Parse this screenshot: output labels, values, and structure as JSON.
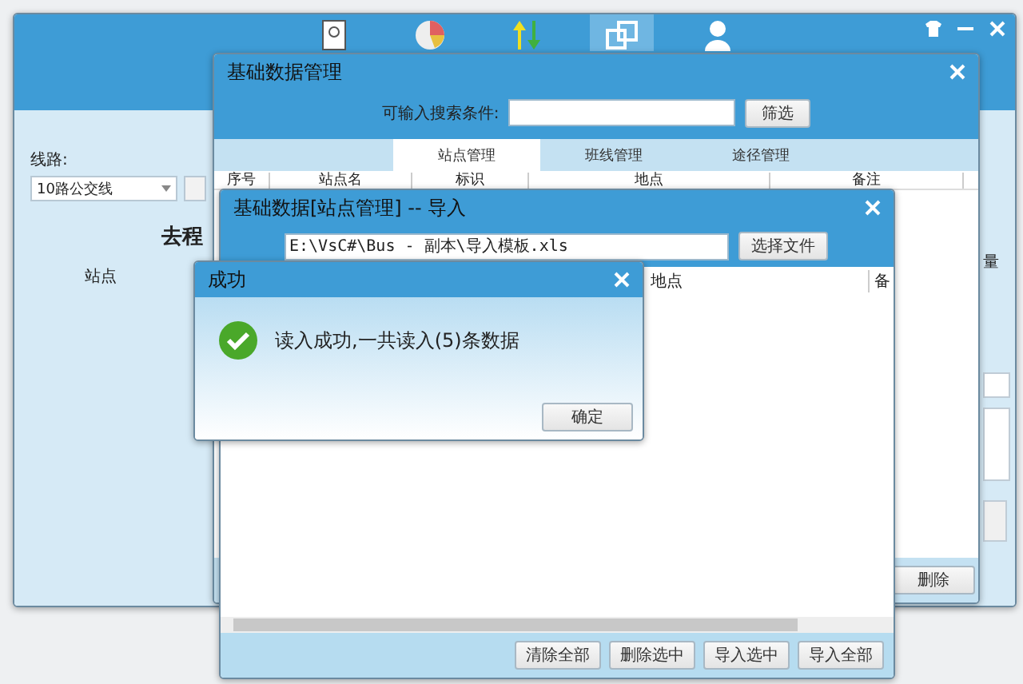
{
  "main_window": {
    "toolbar": [
      {
        "kind": "report",
        "selected": false
      },
      {
        "kind": "chart",
        "selected": false
      },
      {
        "kind": "arrows",
        "selected": false
      },
      {
        "kind": "windows",
        "selected": true
      },
      {
        "kind": "user",
        "selected": false
      }
    ],
    "route_label": "线路:",
    "route_select": "10路公交线",
    "direction": "去程",
    "column_1": "站点",
    "column_2": "量"
  },
  "data_window": {
    "title": "基础数据管理",
    "search_label": "可输入搜索条件:",
    "filter_button": "筛选",
    "tabs": [
      {
        "label": "站点管理",
        "selected": true
      },
      {
        "label": "班线管理",
        "selected": false
      },
      {
        "label": "途径管理",
        "selected": false
      }
    ],
    "columns": [
      "序号",
      "站点名",
      "标识",
      "地点",
      "备注"
    ],
    "delete_button": "删除"
  },
  "import_window": {
    "title": "基础数据[站点管理] -- 导入",
    "path": "E:\\VsC#\\Bus - 副本\\导入模板.xls",
    "choose_button": "选择文件",
    "columns": [
      "地点",
      "备"
    ],
    "buttons": [
      "清除全部",
      "删除选中",
      "导入选中",
      "导入全部"
    ]
  },
  "dialog": {
    "title": "成功",
    "message": "读入成功,一共读入(5)条数据",
    "ok_button": "确定"
  }
}
